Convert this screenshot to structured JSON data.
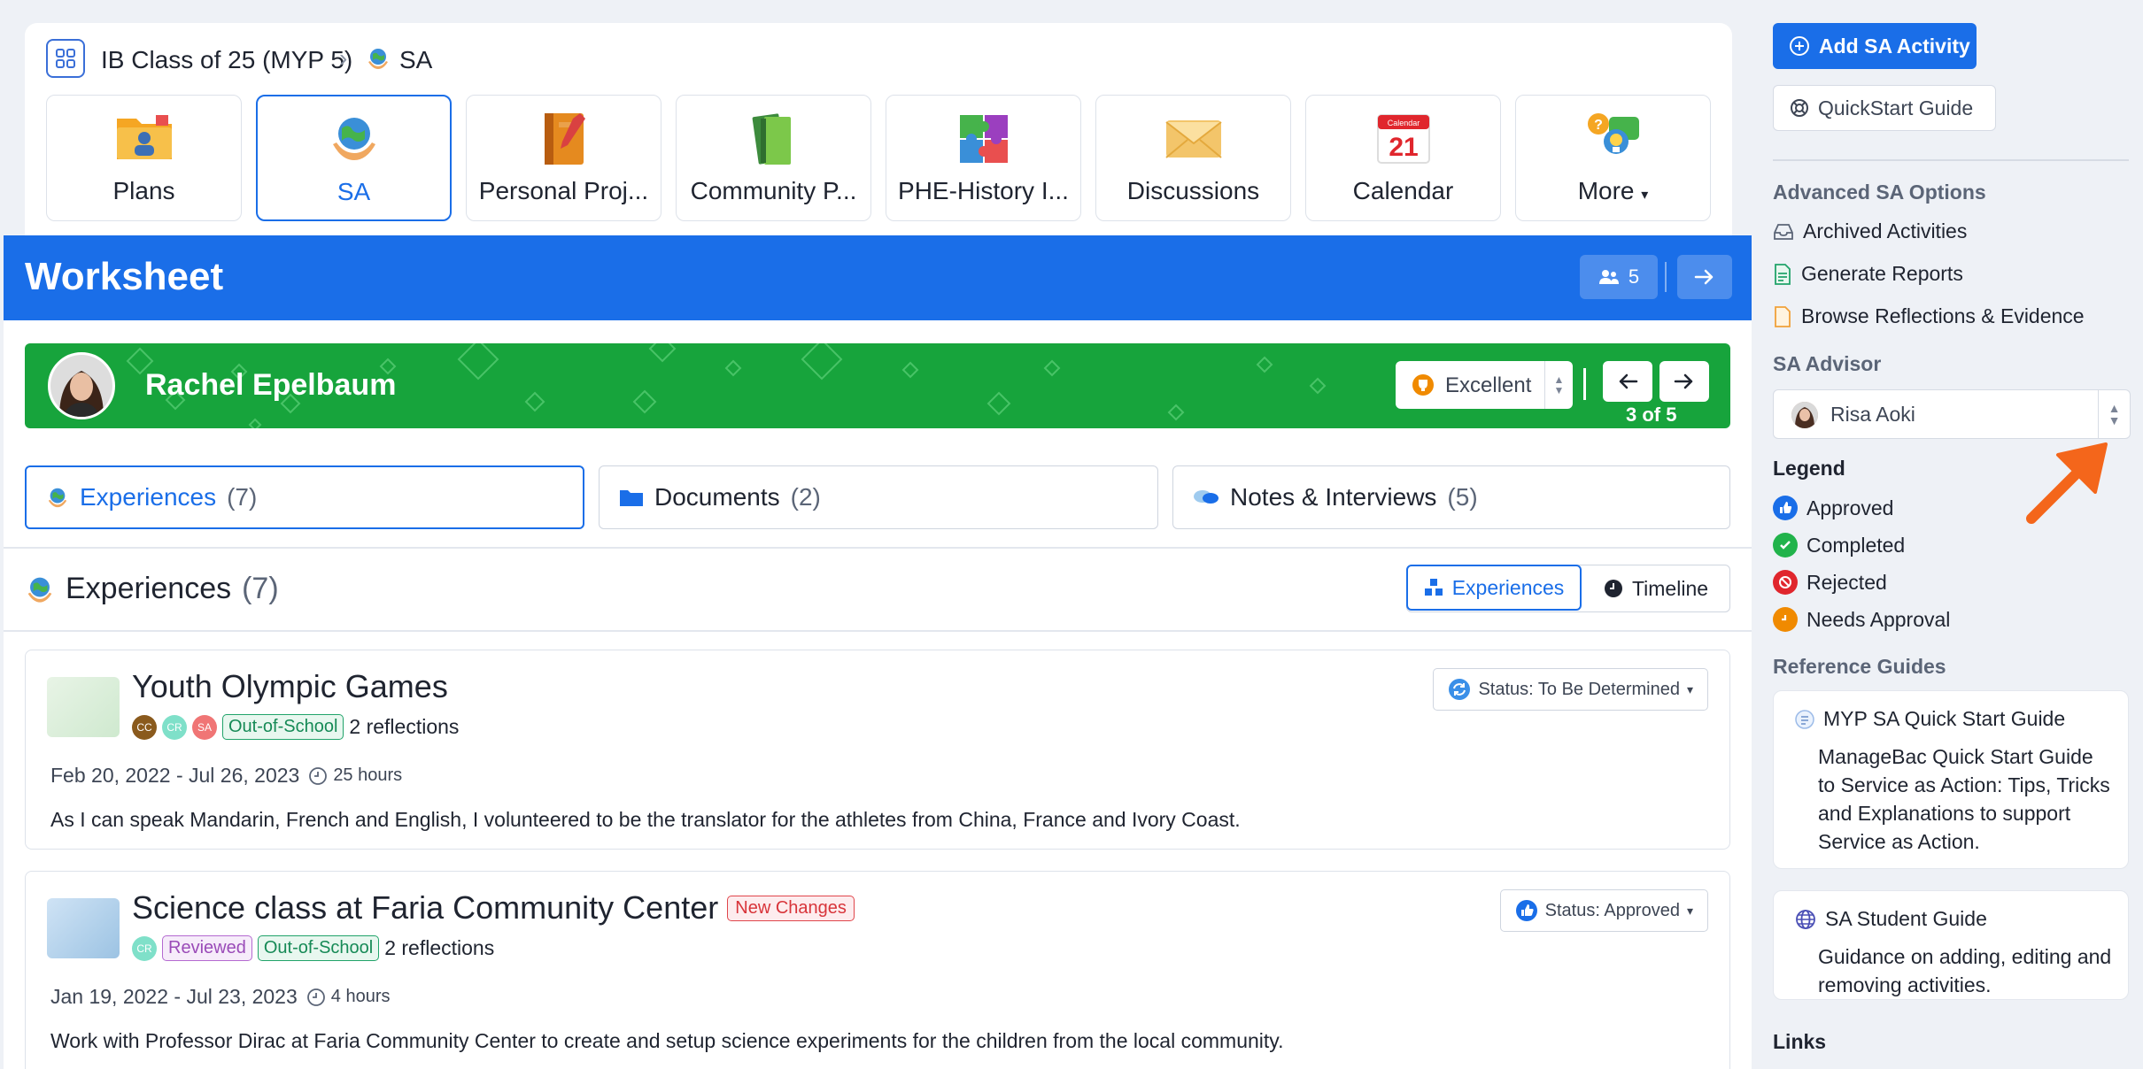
{
  "breadcrumb": {
    "class_name": "IB Class of 25 (MYP 5)",
    "current": "SA"
  },
  "tiles": [
    {
      "label": "Plans"
    },
    {
      "label": "SA"
    },
    {
      "label": "Personal Proj..."
    },
    {
      "label": "Community P..."
    },
    {
      "label": "PHE-History I..."
    },
    {
      "label": "Discussions"
    },
    {
      "label": "Calendar",
      "calendar_day": "21",
      "calendar_header": "Calendar"
    },
    {
      "label": "More"
    }
  ],
  "worksheet": {
    "title": "Worksheet",
    "people_count": "5",
    "student": {
      "name": "Rachel Epelbaum",
      "grade": "Excellent",
      "position": "3 of 5"
    },
    "subtabs": [
      {
        "label": "Experiences",
        "count": "(7)"
      },
      {
        "label": "Documents",
        "count": "(2)"
      },
      {
        "label": "Notes & Interviews",
        "count": "(5)"
      }
    ],
    "section": {
      "title": "Experiences",
      "count": "(7)",
      "view_experiences": "Experiences",
      "view_timeline": "Timeline"
    },
    "activities": [
      {
        "title": "Youth Olympic Games",
        "chips": [
          "CC",
          "CR",
          "SA"
        ],
        "tags": [
          "Out-of-School"
        ],
        "reflections": "2 reflections",
        "dates": "Feb 20, 2022 - Jul 26, 2023",
        "hours": "25 hours",
        "description": "As I can speak Mandarin, French and English, I volunteered to be the translator for the athletes from China, France and Ivory Coast.",
        "status": "Status: To Be Determined"
      },
      {
        "title": "Science class at Faria Community Center",
        "badge": "New Changes",
        "chips": [
          "CR"
        ],
        "tags": [
          "Reviewed",
          "Out-of-School"
        ],
        "reflections": "2 reflections",
        "dates": "Jan 19, 2022 - Jul 23, 2023",
        "hours": "4 hours",
        "description": "Work with Professor Dirac at Faria Community Center to create and setup science experiments for the children from the local community.",
        "status": "Status: Approved"
      }
    ]
  },
  "sidebar": {
    "add_button": "Add SA Activity",
    "quickstart_button": "QuickStart Guide",
    "advanced_heading": "Advanced SA Options",
    "advanced_links": [
      "Archived Activities",
      "Generate Reports",
      "Browse Reflections & Evidence"
    ],
    "advisor_heading": "SA Advisor",
    "advisor_name": "Risa Aoki",
    "legend_heading": "Legend",
    "legend": [
      "Approved",
      "Completed",
      "Rejected",
      "Needs Approval"
    ],
    "legend_colors": [
      "#1a6ee8",
      "#21b34b",
      "#e0262d",
      "#f08a00"
    ],
    "reference_heading": "Reference Guides",
    "guides": [
      {
        "title": "MYP SA Quick Start Guide",
        "desc": "ManageBac Quick Start Guide to Service as Action: Tips, Tricks and Explanations to support Service as Action."
      },
      {
        "title": "SA Student Guide",
        "desc": "Guidance on adding, editing and removing activities."
      }
    ],
    "links_heading": "Links"
  },
  "colors": {
    "accent": "#1a6ee8",
    "student_banner": "#17a43c",
    "arrow": "#f4661b"
  }
}
